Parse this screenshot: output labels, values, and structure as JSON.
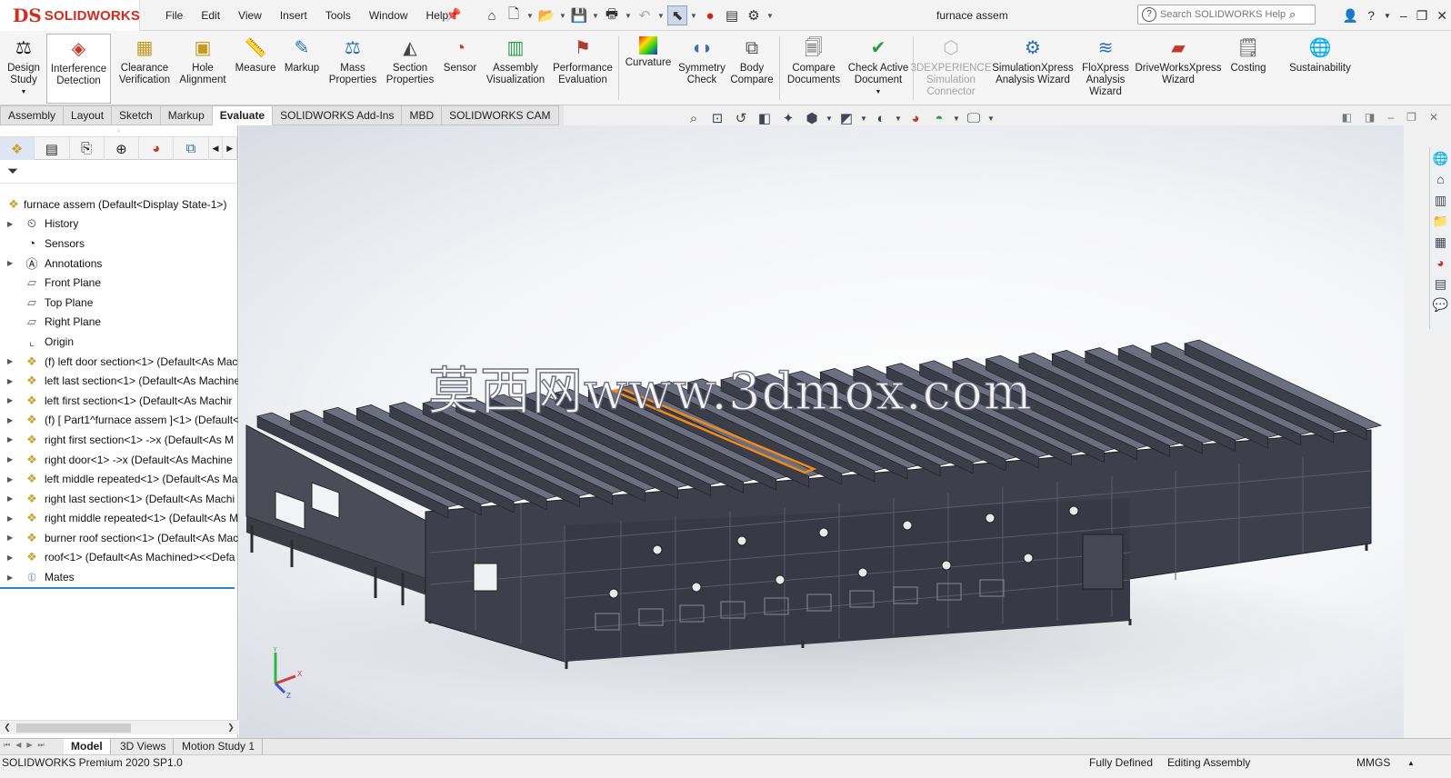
{
  "app": {
    "logo_ds": "DS",
    "logo_name": "SOLIDWORKS",
    "document_title": "furnace assem"
  },
  "menu": [
    "File",
    "Edit",
    "View",
    "Insert",
    "Tools",
    "Window",
    "Help"
  ],
  "search": {
    "placeholder": "Search SOLIDWORKS Help"
  },
  "ribbon": {
    "tools": [
      {
        "label": "Design\nStudy"
      },
      {
        "label": "Interference\nDetection"
      },
      {
        "label": "Clearance\nVerification"
      },
      {
        "label": "Hole\nAlignment"
      },
      {
        "label": "Measure"
      },
      {
        "label": "Markup"
      },
      {
        "label": "Mass\nProperties"
      },
      {
        "label": "Section\nProperties"
      },
      {
        "label": "Sensor"
      },
      {
        "label": "Assembly\nVisualization"
      },
      {
        "label": "Performance\nEvaluation"
      },
      {
        "label": "Curvature"
      },
      {
        "label": "Symmetry\nCheck"
      },
      {
        "label": "Body\nCompare"
      },
      {
        "label": "Compare\nDocuments"
      },
      {
        "label": "Check Active\nDocument"
      },
      {
        "label": "3DEXPERIENCE\nSimulation\nConnector"
      },
      {
        "label": "SimulationXpress\nAnalysis Wizard"
      },
      {
        "label": "FloXpress\nAnalysis\nWizard"
      },
      {
        "label": "DriveWorksXpress\nWizard"
      },
      {
        "label": "Costing"
      },
      {
        "label": "Sustainability"
      }
    ]
  },
  "command_tabs": [
    "Assembly",
    "Layout",
    "Sketch",
    "Markup",
    "Evaluate",
    "SOLIDWORKS Add-Ins",
    "MBD",
    "SOLIDWORKS CAM"
  ],
  "active_command_tab": "Evaluate",
  "tree": {
    "root": "furnace assem  (Default<Display State-1>)",
    "items": [
      {
        "label": "History"
      },
      {
        "label": "Sensors"
      },
      {
        "label": "Annotations"
      },
      {
        "label": "Front Plane"
      },
      {
        "label": "Top Plane"
      },
      {
        "label": "Right Plane"
      },
      {
        "label": "Origin"
      },
      {
        "label": "(f) left door section<1> (Default<As Mac"
      },
      {
        "label": "left last section<1> (Default<As Machine"
      },
      {
        "label": "left first section<1> (Default<As Machir"
      },
      {
        "label": "(f) [ Part1^furnace assem ]<1> (Default<<"
      },
      {
        "label": "right first section<1> ->x (Default<As M"
      },
      {
        "label": "right  door<1> ->x (Default<As Machine"
      },
      {
        "label": "left middle repeated<1> (Default<As Ma"
      },
      {
        "label": "right last section<1> (Default<As Machi"
      },
      {
        "label": "right middle repeated<1> (Default<As M"
      },
      {
        "label": "burner roof section<1> (Default<As Mac"
      },
      {
        "label": "roof<1> (Default<As Machined><<Defa"
      },
      {
        "label": "Mates"
      }
    ]
  },
  "watermark": "莫西网www.3dmox.com",
  "triad": {
    "y": "Y",
    "x": "X",
    "z": "Z"
  },
  "bottom_tabs": [
    "Model",
    "3D Views",
    "Motion Study 1"
  ],
  "active_bottom_tab": "Model",
  "status": {
    "version": "SOLIDWORKS Premium 2020 SP1.0",
    "state": "Fully Defined",
    "mode": "Editing Assembly",
    "units": "MMGS"
  },
  "colors": {
    "logo_red": "#d52b1e",
    "steel": "#3b3d48",
    "beam_top": "#6c6f80",
    "selection": "#f08a1c",
    "tree_accent": "#2a82c8"
  }
}
